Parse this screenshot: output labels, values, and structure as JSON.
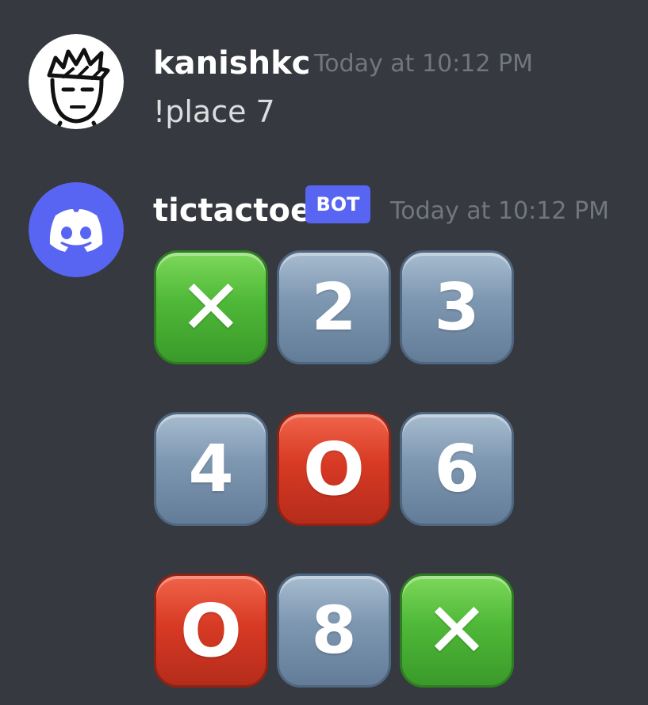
{
  "messages": [
    {
      "author": "kanishkc",
      "timestamp": "Today at 10:12 PM",
      "content": "!place 7",
      "avatar_icon": "doodle-face-avatar"
    },
    {
      "author": "tictactoe",
      "badge": "BOT",
      "timestamp": "Today at 10:12 PM",
      "avatar_icon": "discord-logo-icon"
    }
  ],
  "board": {
    "cells": [
      {
        "type": "x",
        "label": "✕"
      },
      {
        "type": "num",
        "label": "2"
      },
      {
        "type": "num",
        "label": "3"
      },
      {
        "type": "num",
        "label": "4"
      },
      {
        "type": "o",
        "label": "O"
      },
      {
        "type": "num",
        "label": "6"
      },
      {
        "type": "o",
        "label": "O"
      },
      {
        "type": "num",
        "label": "8"
      },
      {
        "type": "x",
        "label": "✕"
      }
    ]
  },
  "colors": {
    "background": "#36393f",
    "bot_badge": "#5865f2",
    "discord_avatar": "#5865f2",
    "timestamp": "#72767d"
  }
}
